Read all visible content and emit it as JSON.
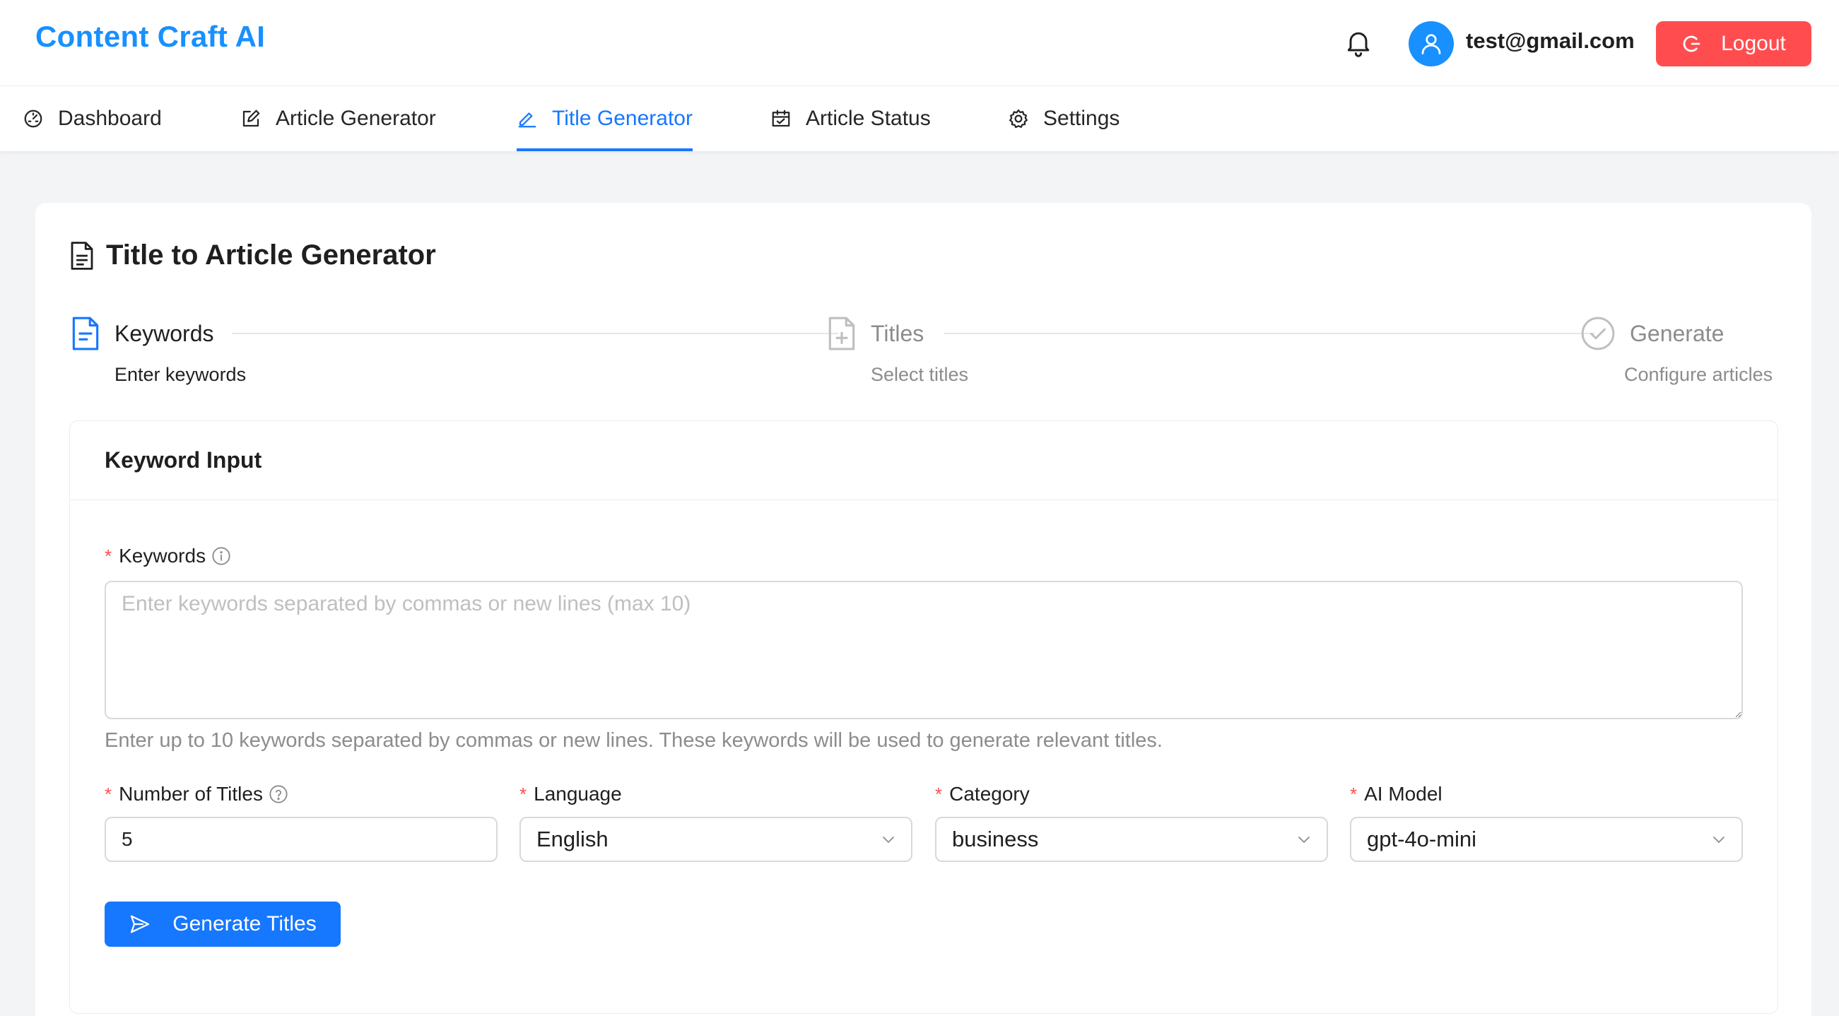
{
  "app": {
    "name": "Content Craft AI"
  },
  "header": {
    "user_email": "test@gmail.com",
    "logout_label": "Logout"
  },
  "nav": {
    "items": [
      {
        "label": "Dashboard",
        "icon": "dashboard-icon"
      },
      {
        "label": "Article Generator",
        "icon": "edit-square-icon"
      },
      {
        "label": "Title Generator",
        "icon": "pencil-icon",
        "active": true
      },
      {
        "label": "Article Status",
        "icon": "calendar-check-icon"
      },
      {
        "label": "Settings",
        "icon": "gear-icon"
      }
    ]
  },
  "page": {
    "title": "Title to Article Generator"
  },
  "steps": [
    {
      "title": "Keywords",
      "desc": "Enter keywords",
      "state": "active"
    },
    {
      "title": "Titles",
      "desc": "Select titles",
      "state": "waiting"
    },
    {
      "title": "Generate",
      "desc": "Configure articles",
      "state": "waiting"
    }
  ],
  "form": {
    "section_title": "Keyword Input",
    "keywords": {
      "label": "Keywords",
      "placeholder": "Enter keywords separated by commas or new lines (max 10)",
      "help": "Enter up to 10 keywords separated by commas or new lines. These keywords will be used to generate relevant titles."
    },
    "num_titles": {
      "label": "Number of Titles",
      "value": "5"
    },
    "language": {
      "label": "Language",
      "value": "English"
    },
    "category": {
      "label": "Category",
      "value": "business"
    },
    "ai_model": {
      "label": "AI Model",
      "value": "gpt-4o-mini"
    },
    "submit_label": "Generate Titles"
  },
  "colors": {
    "primary": "#1677ff",
    "brand": "#1890ff",
    "danger": "#ff4d4f",
    "muted": "#8c8c8c",
    "page_bg": "#f3f4f6"
  }
}
